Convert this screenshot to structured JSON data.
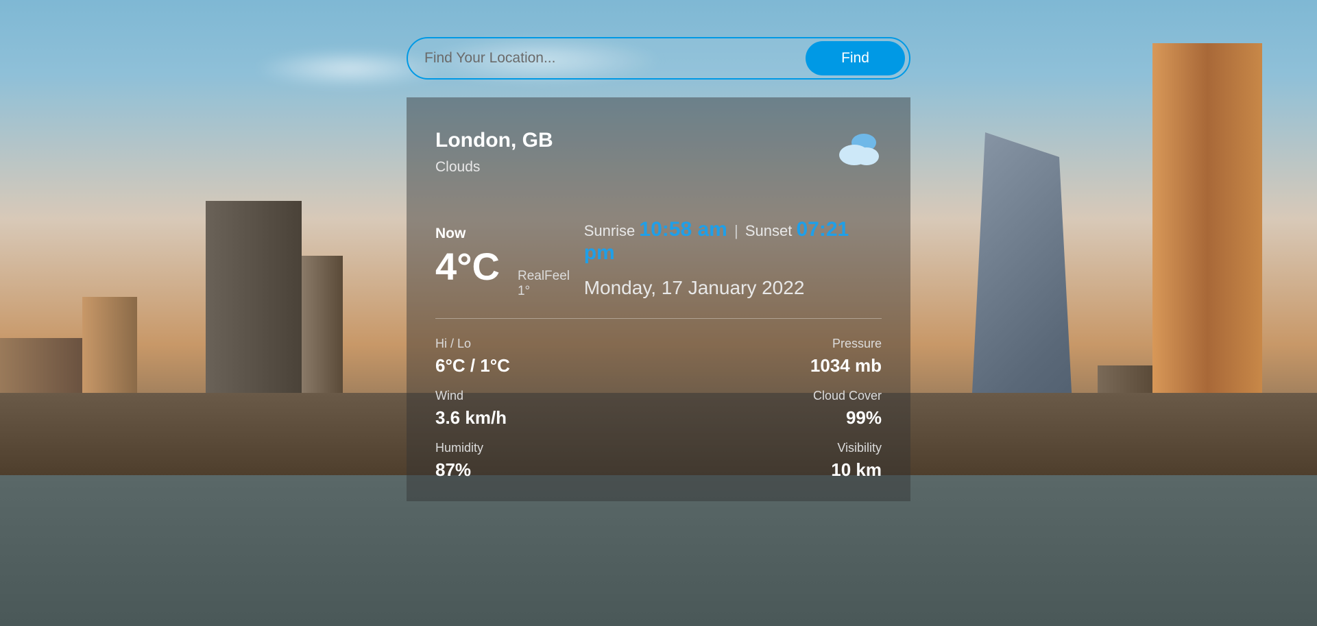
{
  "search": {
    "placeholder": "Find Your Location...",
    "button_label": "Find"
  },
  "weather": {
    "location": "London, GB",
    "condition": "Clouds",
    "now_label": "Now",
    "temperature": "4°C",
    "realfeel": "RealFeel 1°",
    "sunrise_label": "Sunrise",
    "sunrise_time": "10:58 am",
    "sunset_label": "Sunset",
    "sunset_time": "07:21 pm",
    "separator": "|",
    "date": "Monday, 17 January 2022",
    "stats": {
      "hilo_label": "Hi / Lo",
      "hilo_value": "6°C / 1°C",
      "wind_label": "Wind",
      "wind_value": "3.6 km/h",
      "humidity_label": "Humidity",
      "humidity_value": "87%",
      "pressure_label": "Pressure",
      "pressure_value": "1034 mb",
      "cloud_label": "Cloud Cover",
      "cloud_value": "99%",
      "visibility_label": "Visibility",
      "visibility_value": "10 km"
    }
  },
  "colors": {
    "accent": "#0099e5",
    "highlight": "#1f9fe8"
  }
}
